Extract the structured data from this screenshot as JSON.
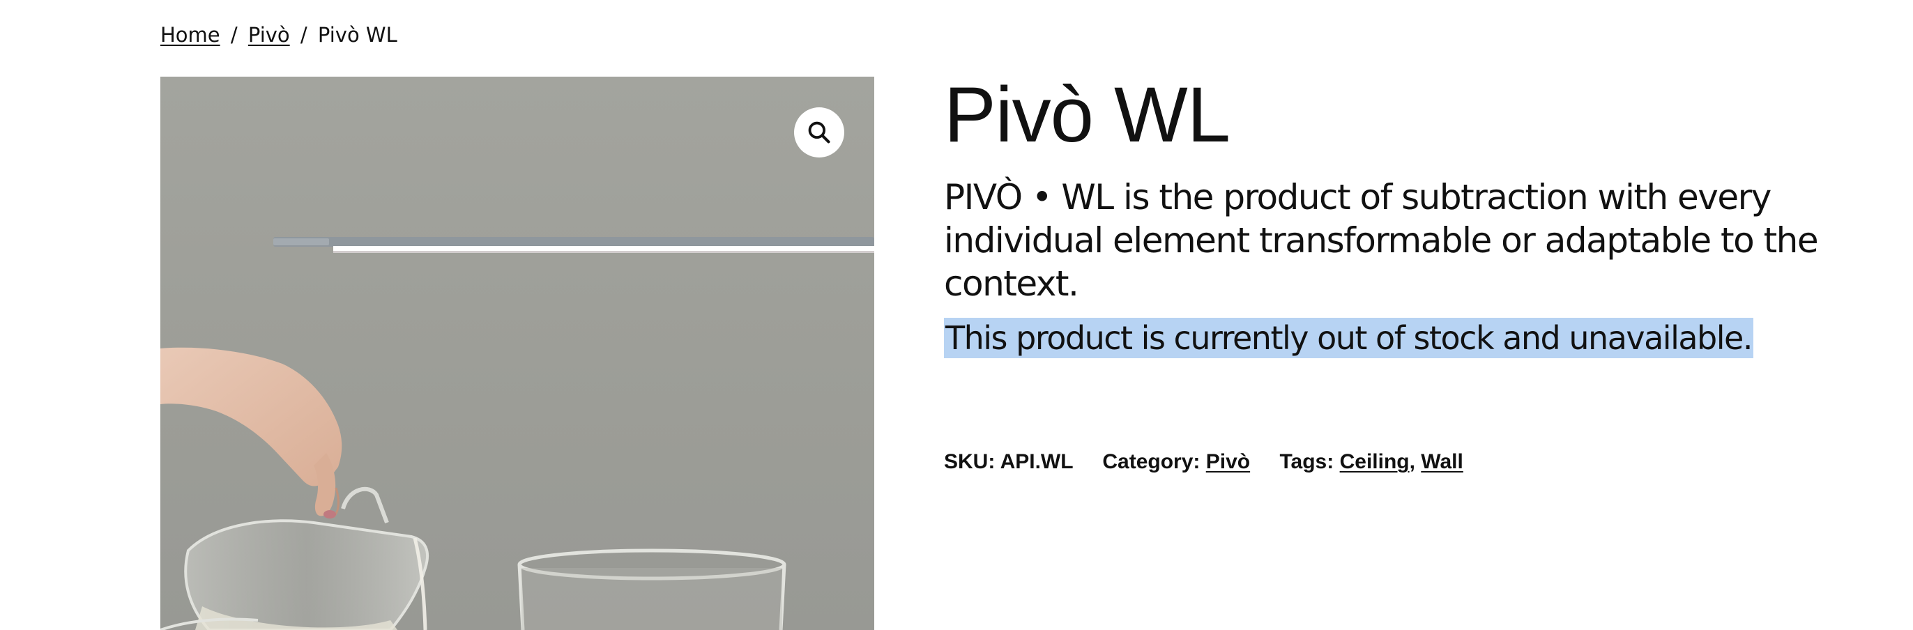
{
  "breadcrumb": {
    "items": [
      {
        "label": "Home"
      },
      {
        "label": "Pivò"
      },
      {
        "label": "Pivò WL"
      }
    ],
    "separator": "/"
  },
  "gallery": {
    "image_alt": "Pivò WL lamp above a table with a hand pouring from a glass jug",
    "zoom_icon": "magnifier-icon"
  },
  "product": {
    "title": "Pivò WL",
    "description": "PIVÒ • WL is the product of subtraction with every individual element transformable or adaptable to the context.",
    "stock_message": "This product is currently out of stock and unavailable."
  },
  "meta": {
    "sku_label": "SKU:",
    "sku_value": "API.WL",
    "category_label": "Category:",
    "category_value": "Pivò",
    "tags_label": "Tags:",
    "tags": [
      "Ceiling",
      "Wall"
    ],
    "tag_separator": ","
  },
  "colors": {
    "text": "#111111",
    "highlight": "#b7d3f3",
    "background": "#ffffff"
  }
}
